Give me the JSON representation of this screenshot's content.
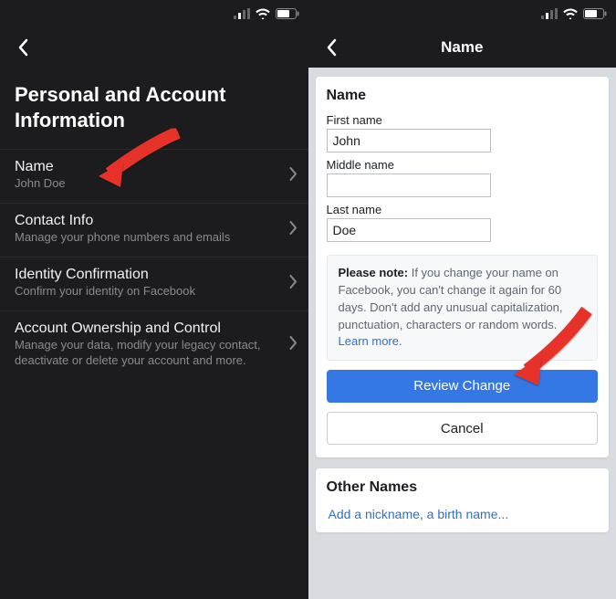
{
  "status": {
    "signal_icon": "signal-icon",
    "wifi_icon": "wifi-icon",
    "battery_icon": "battery-icon"
  },
  "left": {
    "page_title": "Personal and Account Information",
    "rows": [
      {
        "title": "Name",
        "sub": "John Doe"
      },
      {
        "title": "Contact Info",
        "sub": "Manage your phone numbers and emails"
      },
      {
        "title": "Identity Confirmation",
        "sub": "Confirm your identity on Facebook"
      },
      {
        "title": "Account Ownership and Control",
        "sub": "Manage your data, modify your legacy contact, deactivate or delete your account and more."
      }
    ]
  },
  "right": {
    "nav_title": "Name",
    "card_title": "Name",
    "first_label": "First name",
    "first_value": "John",
    "middle_label": "Middle name",
    "middle_value": "",
    "last_label": "Last name",
    "last_value": "Doe",
    "note_bold": "Please note:",
    "note_text": " If you change your name on Facebook, you can't change it again for 60 days. Don't add any unusual capitalization, punctuation, characters or random words. ",
    "note_link": "Learn more",
    "note_period": ".",
    "review_btn": "Review Change",
    "cancel_btn": "Cancel",
    "other_title": "Other Names",
    "other_link": "Add a nickname, a birth name..."
  }
}
